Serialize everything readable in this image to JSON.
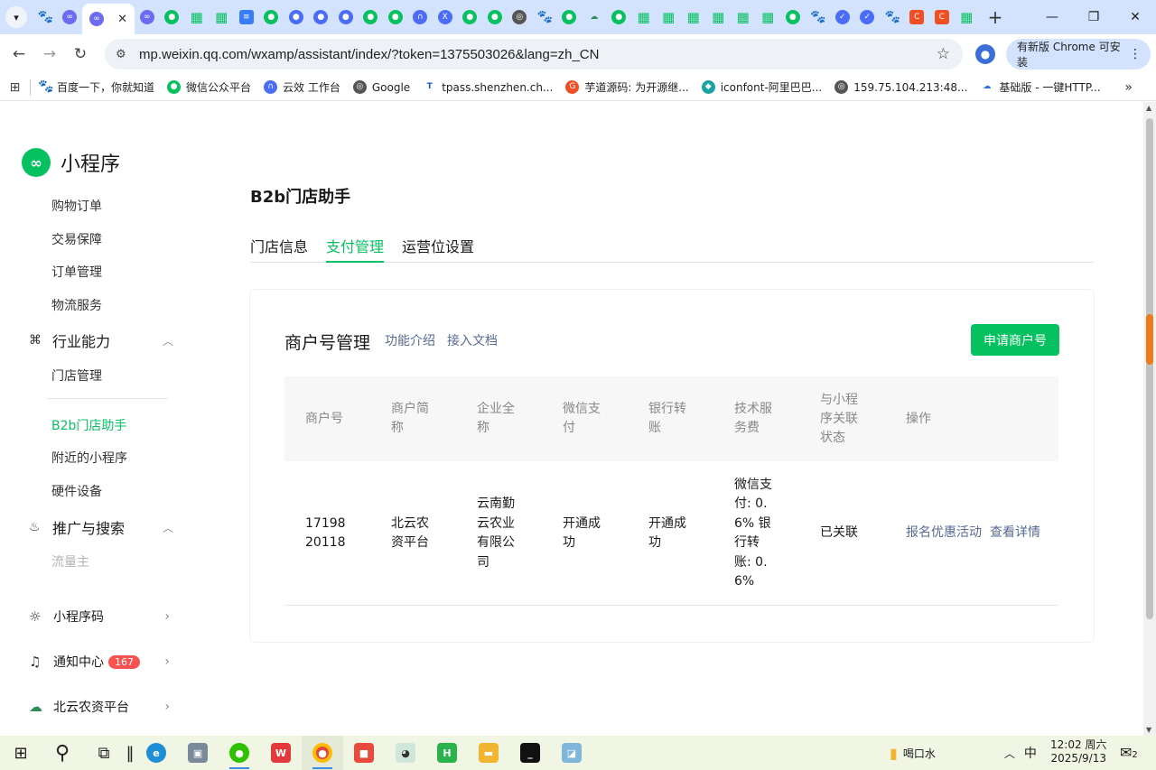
{
  "browser": {
    "url": "mp.weixin.qq.com/wxamp/assistant/index/?token=1375503026&lang=zh_CN",
    "update_label": "有新版 Chrome 可安装",
    "bookmarks": [
      {
        "label": "百度一下，你就知道",
        "icon": "paw-icon"
      },
      {
        "label": "微信公众平台",
        "icon": "wechat-icon"
      },
      {
        "label": "云效 工作台",
        "icon": "yunxiao-icon"
      },
      {
        "label": "Google",
        "icon": "globe-icon"
      },
      {
        "label": "tpass.shenzhen.ch...",
        "icon": "tpass-icon"
      },
      {
        "label": "芋道源码: 为开源继...",
        "icon": "yudao-icon"
      },
      {
        "label": "iconfont-阿里巴巴...",
        "icon": "iconfont-icon"
      },
      {
        "label": "159.75.104.213:48...",
        "icon": "globe-icon"
      },
      {
        "label": "基础版 - 一键HTTP...",
        "icon": "cloud-icon"
      }
    ]
  },
  "sidebar": {
    "logo_text": "小程序",
    "items_top": [
      "购物订单",
      "交易保障",
      "订单管理",
      "物流服务"
    ],
    "group_industry": "行业能力",
    "items_industry": [
      "门店管理",
      "B2b门店助手",
      "附近的小程序",
      "硬件设备"
    ],
    "group_promo": "推广与搜索",
    "items_promo": [
      "流量主"
    ],
    "bottom": [
      {
        "label": "小程序码",
        "icon": "qrcode-icon"
      },
      {
        "label": "通知中心",
        "icon": "bell-icon",
        "badge": "167"
      },
      {
        "label": "北云农资平台",
        "icon": "cloud-icon"
      }
    ]
  },
  "main": {
    "title": "B2b门店助手",
    "tabs": [
      "门店信息",
      "支付管理",
      "运营位设置"
    ],
    "active_tab": "支付管理",
    "panel": {
      "title": "商户号管理",
      "links": [
        "功能介绍",
        "接入文档"
      ],
      "apply_button": "申请商户号",
      "columns": [
        "商户号",
        "商户简称",
        "企业全称",
        "微信支付",
        "银行转账",
        "技术服务费",
        "与小程序关联状态",
        "操作"
      ],
      "rows": [
        {
          "merchant_id": "1719820118",
          "short_name": "北云农资平台",
          "full_name": "云南勤云农业有限公司",
          "wechat_pay": "开通成功",
          "bank_transfer": "开通成功",
          "service_fee": "微信支付: 0.6% 银行转账: 0.6%",
          "link_status": "已关联",
          "actions": [
            "报名优惠活动",
            "查看详情"
          ]
        }
      ]
    }
  },
  "taskbar": {
    "tray_label": "喝口水",
    "ime": "中",
    "time": "12:02 周六",
    "date": "2025/9/13",
    "notification_count": "2"
  },
  "colors": {
    "accent": "#07c160",
    "link": "#576b95",
    "badge": "#fa5151"
  }
}
